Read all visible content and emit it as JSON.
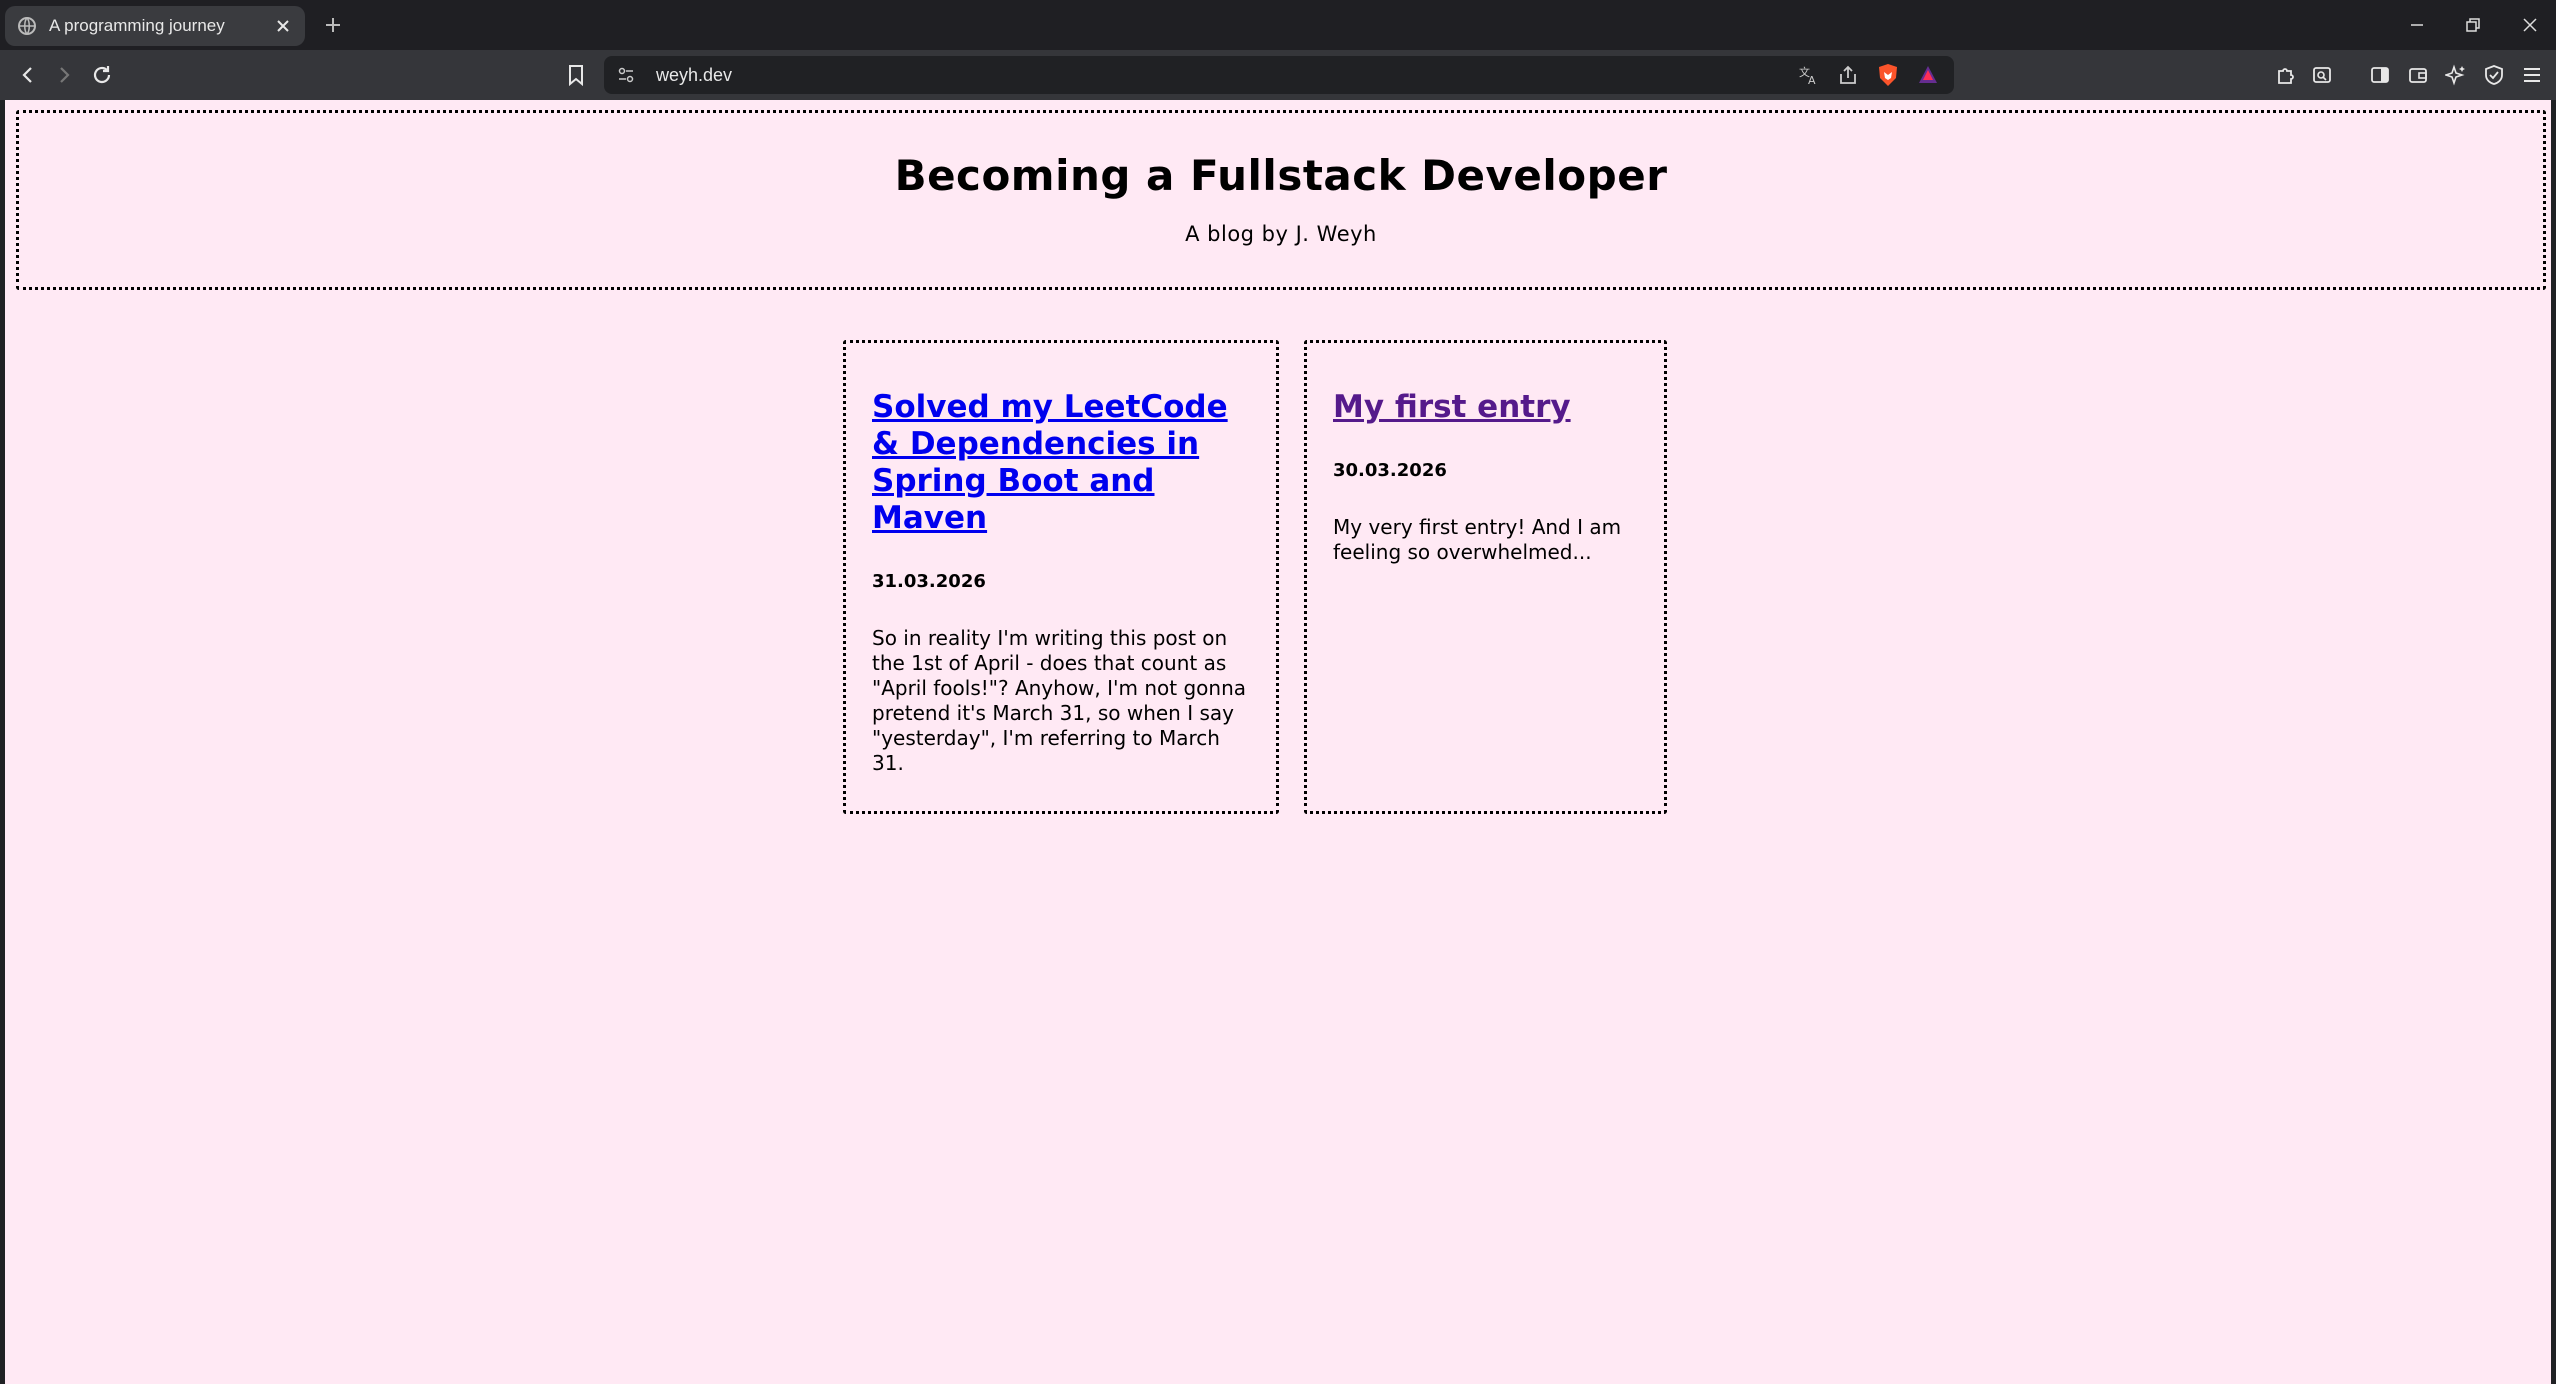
{
  "browser": {
    "tab_title": "A programming journey",
    "url": "weyh.dev",
    "icons": [
      "globe-icon",
      "close-icon",
      "plus-icon",
      "minimize-icon",
      "restore-icon",
      "back-icon",
      "forward-icon",
      "reload-icon",
      "bookmark-icon",
      "site-info-icon",
      "translate-icon",
      "share-icon",
      "brave-shield-icon",
      "brave-rewards-icon",
      "extensions-icon",
      "search-tabs-icon",
      "sidebar-icon",
      "wallet-icon",
      "leo-ai-icon",
      "vpn-icon",
      "menu-icon"
    ]
  },
  "header": {
    "title": "Becoming a Fullstack Developer",
    "subtitle": "A blog by J. Weyh"
  },
  "posts": [
    {
      "title": "Solved my LeetCode & Dependencies in Spring Boot and Maven",
      "date": "31.03.2026",
      "excerpt": "So in reality I'm writing this post on the 1st of April - does that count as \"April fools!\"? Anyhow, I'm not gonna pretend it's March 31, so when I say \"yesterday\", I'm referring to March 31."
    },
    {
      "title": "My first entry",
      "date": "30.03.2026",
      "excerpt": "My very first entry! And I am feeling so overwhelmed..."
    }
  ],
  "colors": {
    "page_background": "#ffe9f4",
    "link_unvisited": "#0000ee",
    "link_visited": "#551a8b"
  }
}
